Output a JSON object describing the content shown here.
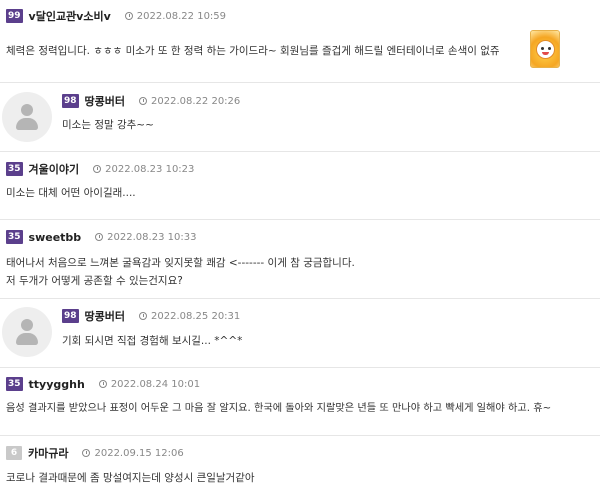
{
  "comments": [
    {
      "level": "99",
      "nickname": "v달인교관v소비v",
      "timestamp": "2022.08.22 10:59",
      "lines": [
        "체력은 정력입니다. ㅎㅎㅎ 미소가 또 한 정력 하는 가이드라~ 회원님를 즐겁게 해드릴 엔터테이너로 손색이 없쥬"
      ],
      "has_emoticon": true
    },
    {
      "level": "98",
      "nickname": "땅콩버터",
      "timestamp": "2022.08.22 20:26",
      "lines": [
        "미소는 정말 강추~~"
      ],
      "is_reply": true
    },
    {
      "level": "35",
      "nickname": "겨울이야기",
      "timestamp": "2022.08.23 10:23",
      "lines": [
        "미소는 대체 어떤 아이길래...."
      ]
    },
    {
      "level": "35",
      "nickname": "sweetbb",
      "timestamp": "2022.08.23 10:33",
      "lines": [
        "태어나서 처음으로 느껴본 굴욕감과 잊지못할 쾌감 <------- 이게 참 궁금합니다.",
        "저 두개가 어떻게 공존할 수 있는건지요?"
      ]
    },
    {
      "level": "98",
      "nickname": "땅콩버터",
      "timestamp": "2022.08.25 20:31",
      "lines": [
        "기회 되시면 직접 경험해 보시길... *^^*"
      ],
      "is_reply": true
    },
    {
      "level": "35",
      "nickname": "ttyygghh",
      "timestamp": "2022.08.24 10:01",
      "lines": [
        "음성 결과지를 받았으나 표정이 어두운 그 마음 잘 알지요. 한국에 돌아와 지랄맞은 년들 또 만나야 하고 빡세게 일해야 하고. 휴~"
      ]
    },
    {
      "level": "6",
      "nickname": "카마규라",
      "timestamp": "2022.09.15 12:06",
      "lines": [
        "코로나 결과때문에 좀 망설여지는데 양성시 큰일날거같아"
      ],
      "level_style": "grey"
    }
  ]
}
